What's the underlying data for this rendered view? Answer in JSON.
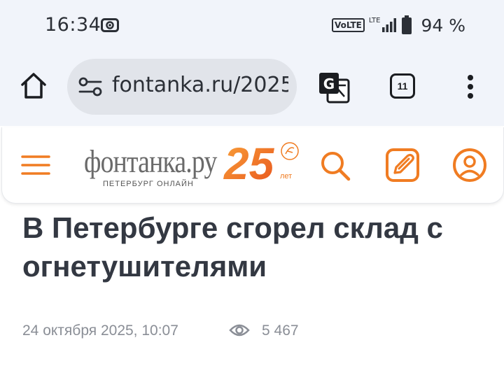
{
  "status_bar": {
    "time": "16:34",
    "volte": "VoLTE",
    "lte": "LTE",
    "battery_percent": "94 %"
  },
  "browser": {
    "url": "fontanka.ru/2025",
    "tab_count": "11"
  },
  "site": {
    "logo_text": "фонтанка.ру",
    "logo_subtitle": "ПЕТЕРБУРГ ОНЛАЙН",
    "anniversary_number": "25",
    "anniversary_suffix": "лет",
    "accent_color": "#f07c22"
  },
  "article": {
    "title": "В Петербурге сгорел склад с огнетушителями",
    "date": "24 октября 2025, 10:07",
    "views": "5 467"
  },
  "icons": [
    "screen-record-icon",
    "signal-icon",
    "battery-icon",
    "home-icon",
    "site-settings-icon",
    "translate-icon",
    "tabs-icon",
    "more-vert-icon",
    "menu-icon",
    "search-icon",
    "edit-icon",
    "profile-icon",
    "eye-icon"
  ]
}
